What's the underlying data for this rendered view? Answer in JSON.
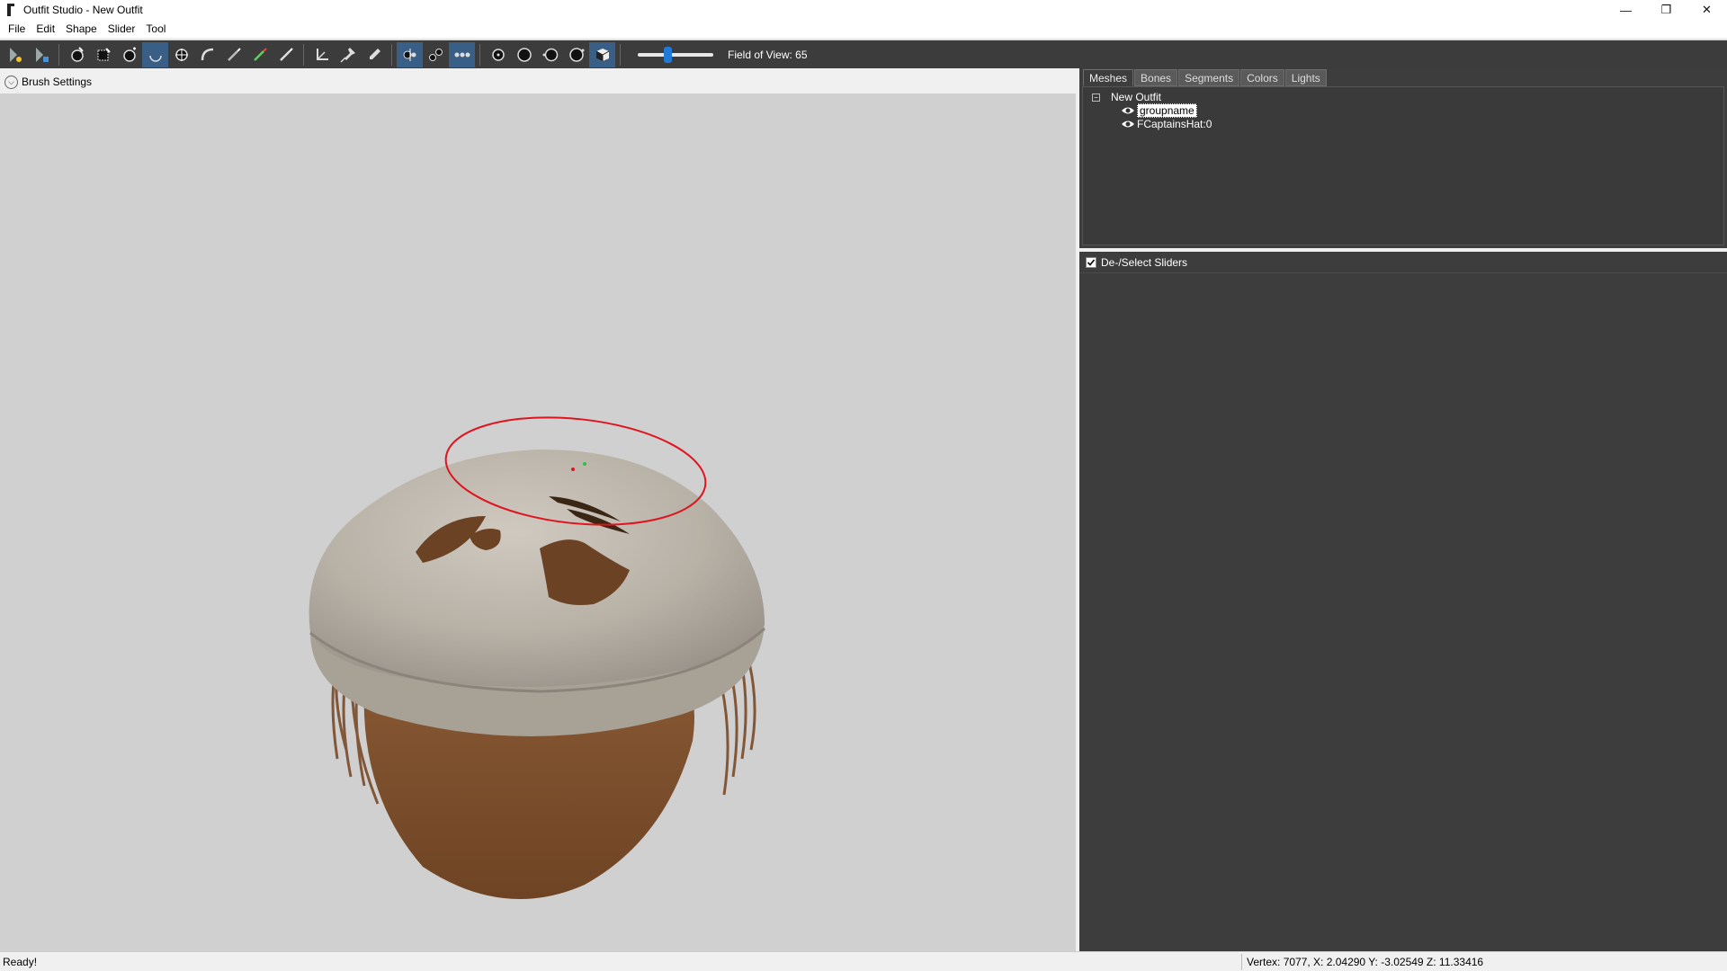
{
  "window": {
    "title": "Outfit Studio - New Outfit"
  },
  "menu": [
    "File",
    "Edit",
    "Shape",
    "Slider",
    "Tool"
  ],
  "toolbar": {
    "fov_label": "Field of View: 65",
    "fov_value": 65
  },
  "brush_settings": {
    "label": "Brush Settings"
  },
  "panel": {
    "tabs": [
      "Meshes",
      "Bones",
      "Segments",
      "Colors",
      "Lights"
    ],
    "active_tab": "Meshes",
    "tree": {
      "root": "New Outfit",
      "items": [
        "groupname",
        "FCaptainsHat:0"
      ],
      "selected": "groupname"
    },
    "sliders_header": "De-/Select Sliders"
  },
  "status": {
    "left": "Ready!",
    "right": "Vertex: 7077, X: 2.04290 Y: -3.02549 Z: 11.33416"
  },
  "colors": {
    "viewport_bg": "#d0d0d0",
    "panel_bg": "#3d3d3d",
    "brush_circle": "#e0141e",
    "accent": "#1f7ad8"
  }
}
